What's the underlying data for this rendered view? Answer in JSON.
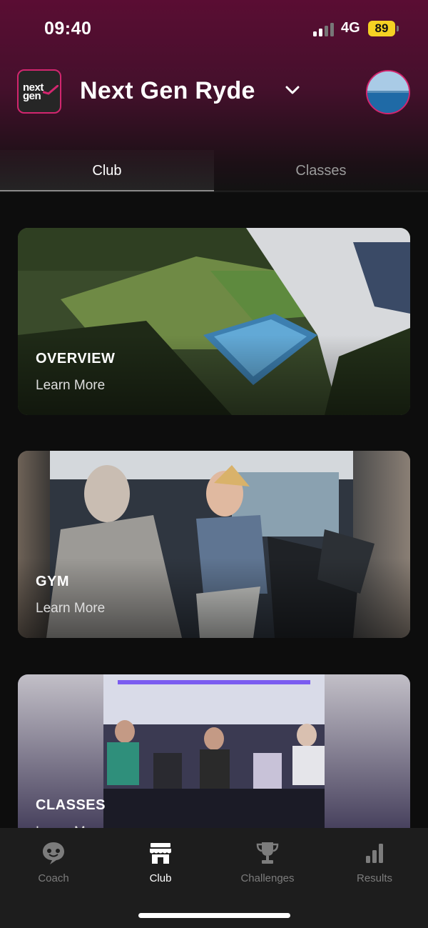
{
  "status_bar": {
    "time": "09:40",
    "network": "4G",
    "battery": "89",
    "battery_color": "#f5d223"
  },
  "header": {
    "logo_text_line1": "next",
    "logo_text_line2": "gen",
    "club_name": "Next Gen Ryde",
    "dropdown_icon": "chevron-down-icon",
    "avatar_icon": "profile-avatar"
  },
  "tabs": [
    {
      "label": "Club",
      "active": true
    },
    {
      "label": "Classes",
      "active": false
    }
  ],
  "cards": [
    {
      "title": "OVERVIEW",
      "link": "Learn More"
    },
    {
      "title": "GYM",
      "link": "Learn More"
    },
    {
      "title": "CLASSES",
      "link": "Learn More"
    }
  ],
  "bottom_nav": [
    {
      "label": "Coach",
      "icon": "chat-bubble-icon",
      "active": false
    },
    {
      "label": "Club",
      "icon": "storefront-icon",
      "active": true
    },
    {
      "label": "Challenges",
      "icon": "trophy-icon",
      "active": false
    },
    {
      "label": "Results",
      "icon": "bar-chart-icon",
      "active": false
    }
  ],
  "colors": {
    "brand_magenta": "#d2266f",
    "header_gradient_top": "#5a0d33",
    "background": "#0d0d0d",
    "nav_background": "#1d1d1d"
  }
}
